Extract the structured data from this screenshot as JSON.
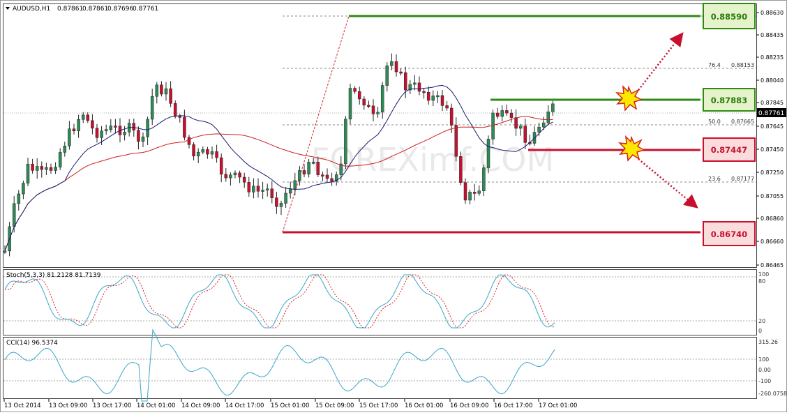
{
  "symbol_header": {
    "symbol": "AUDUSD,H1",
    "open": "0.87861",
    "high": "0.87861",
    "low": "0.87696",
    "close": "0.87761"
  },
  "price_scale": {
    "ticks": [
      "0.88630",
      "0.88435",
      "0.88235",
      "0.88040",
      "0.87845",
      "0.87645",
      "0.87450",
      "0.87250",
      "0.87055",
      "0.86860",
      "0.86660",
      "0.86465"
    ],
    "current_price": "0.87761"
  },
  "levels": [
    {
      "label": "0.88590",
      "color": "#2e8b11",
      "role": "target"
    },
    {
      "label": "0.87883",
      "color": "#2e8b11",
      "role": "resistance"
    },
    {
      "label": "0.87447",
      "color": "#d40000",
      "role": "support"
    },
    {
      "label": "0.86740",
      "color": "#d40000",
      "role": "target"
    }
  ],
  "fibonacci": [
    {
      "ratio": "76.4",
      "price": "0.88153"
    },
    {
      "ratio": "50.0",
      "price": "0.87665"
    },
    {
      "ratio": "23.6",
      "price": "0.87177"
    }
  ],
  "stochastic": {
    "title": "Stoch(5,3,3) 81.2128 81.7139",
    "scale": [
      "100",
      "80",
      "20",
      "0"
    ]
  },
  "cci": {
    "title": "CCI(14) 96.5374",
    "scale": [
      "315.26",
      "100",
      "0.00",
      "-100",
      "-260.0758"
    ]
  },
  "time_axis": [
    "13 Oct 2014",
    "13 Oct 09:00",
    "13 Oct 17:00",
    "14 Oct 01:00",
    "14 Oct 09:00",
    "14 Oct 17:00",
    "15 Oct 01:00",
    "15 Oct 09:00",
    "15 Oct 17:00",
    "16 Oct 01:00",
    "16 Oct 09:00",
    "16 Oct 17:00",
    "17 Oct 01:00"
  ],
  "watermark": "FOREXimf.COM",
  "colors": {
    "bull_candle": "#2e8b57",
    "bear_candle": "#c8102e",
    "ma_fast": "#1a1a6e",
    "ma_slow": "#cc2020",
    "stoch_main": "#3aa6c9",
    "stoch_signal": "#d42020",
    "cci_line": "#3aa6c9"
  }
}
